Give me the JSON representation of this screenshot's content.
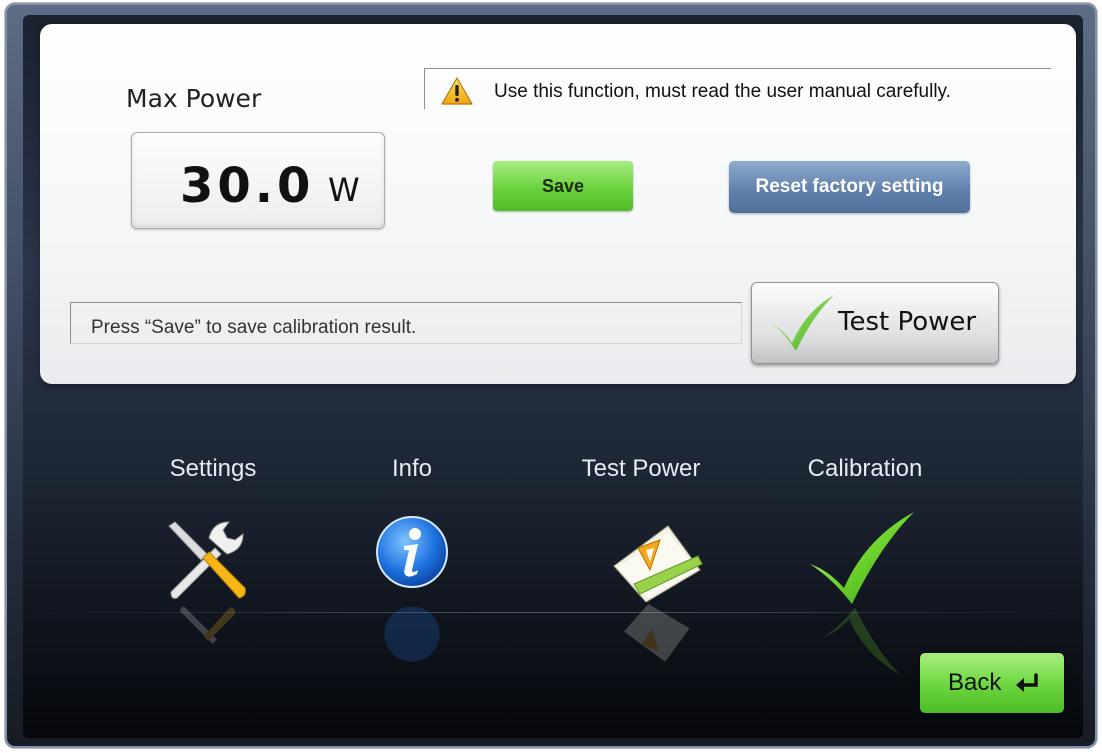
{
  "panel": {
    "max_power_label": "Max Power",
    "power_value": "30.0",
    "power_unit": "W",
    "warning_text": "Use this function, must read the user manual carefully.",
    "save_label": "Save",
    "reset_label": "Reset factory setting",
    "status_text": "Press “Save” to save calibration result.",
    "test_power_label": "Test Power"
  },
  "nav": {
    "items": [
      {
        "label": "Settings",
        "icon": "wrench-screwdriver-icon"
      },
      {
        "label": "Info",
        "icon": "info-icon"
      },
      {
        "label": "Test Power",
        "icon": "ruler-triangle-icon"
      },
      {
        "label": "Calibration",
        "icon": "checkmark-icon"
      }
    ],
    "back_label": "Back"
  },
  "colors": {
    "accent_green": "#6bd23f",
    "reset_blue": "#5f7fab",
    "frame_dark": "#27303f"
  }
}
